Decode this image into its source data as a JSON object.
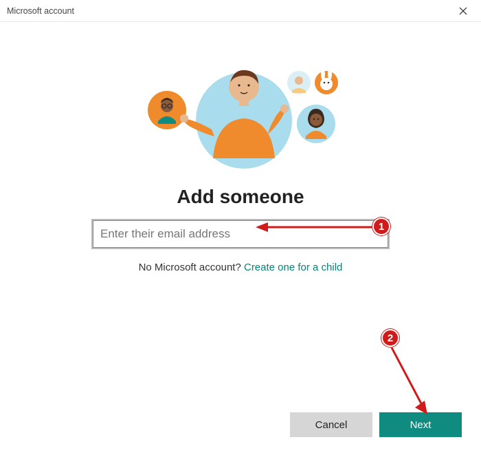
{
  "window": {
    "title": "Microsoft account"
  },
  "main": {
    "heading": "Add someone",
    "email_placeholder": "Enter their email address",
    "email_value": "",
    "no_account_text": "No Microsoft account? ",
    "create_link": "Create one for a child"
  },
  "footer": {
    "cancel_label": "Cancel",
    "next_label": "Next"
  },
  "annotations": {
    "badge1": "1",
    "badge2": "2"
  },
  "colors": {
    "accent": "#0f8b7f",
    "annotation": "#d11a1a",
    "orange": "#ef8b2c",
    "blue": "#8fd3e8"
  }
}
